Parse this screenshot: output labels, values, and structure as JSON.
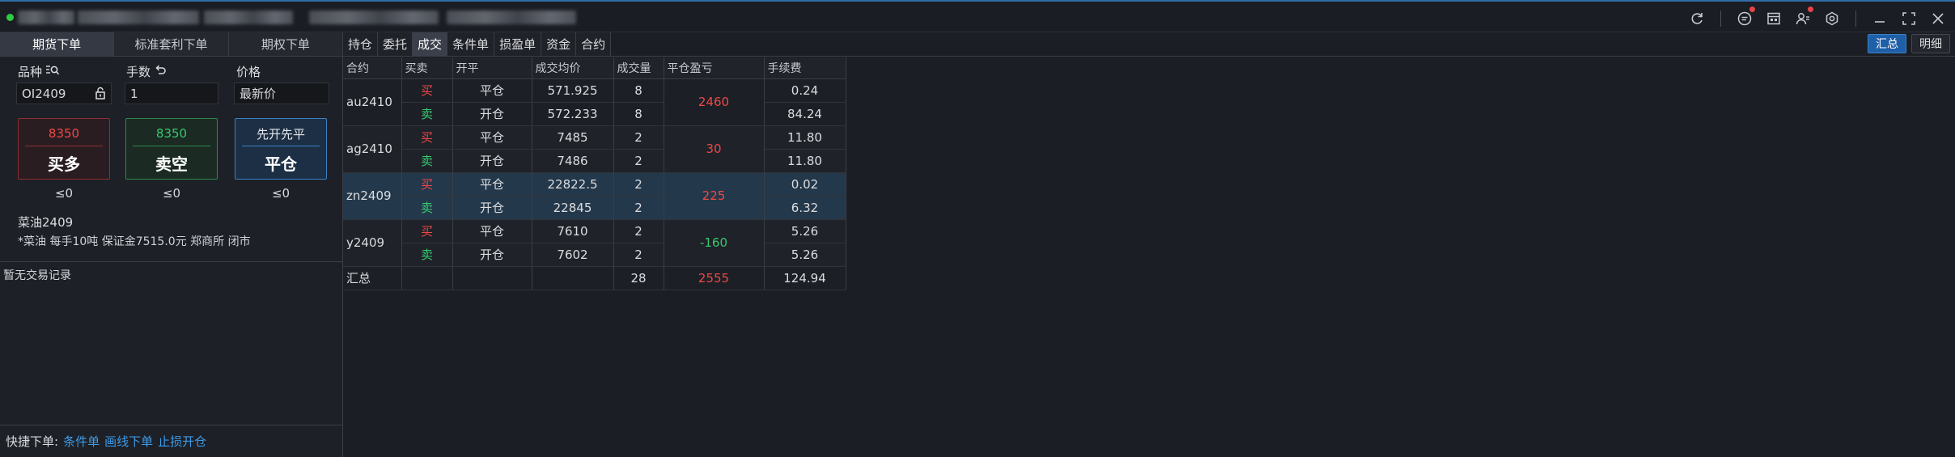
{
  "left": {
    "tabs": [
      "期货下单",
      "标准套利下单",
      "期权下单"
    ],
    "active_tab": 0,
    "labels": {
      "symbol": "品种",
      "lots": "手数",
      "price": "价格"
    },
    "inputs": {
      "symbol": "OI2409",
      "lots": "1",
      "price": "最新价"
    },
    "buy": {
      "price": "8350",
      "label": "买多",
      "limit": "≤0"
    },
    "sell": {
      "price": "8350",
      "label": "卖空",
      "limit": "≤0"
    },
    "close": {
      "hint": "先开先平",
      "label": "平仓",
      "limit": "≤0"
    },
    "contract_name": "菜油2409",
    "contract_info": "*菜油 每手10吨 保证金7515.0元 郑商所 闭市",
    "no_record": "暂无交易记录",
    "quick": {
      "label": "快捷下单:",
      "links": [
        "条件单",
        "画线下单",
        "止损开仓"
      ]
    }
  },
  "right": {
    "tabs": [
      "持仓",
      "委托",
      "成交",
      "条件单",
      "损盈单",
      "资金",
      "合约"
    ],
    "active_tab": 2,
    "view_buttons": [
      "汇总",
      "明细"
    ],
    "active_view": 0,
    "columns": [
      "合约",
      "买卖",
      "开平",
      "成交均价",
      "成交量",
      "平仓盈亏",
      "手续费"
    ],
    "groups": [
      {
        "symbol": "au2410",
        "pnl": "2460",
        "pnl_sign": "pos",
        "rows": [
          {
            "side": "买",
            "offset": "平仓",
            "avg": "571.925",
            "vol": "8",
            "fee": "0.24"
          },
          {
            "side": "卖",
            "offset": "开仓",
            "avg": "572.233",
            "vol": "8",
            "fee": "84.24"
          }
        ]
      },
      {
        "symbol": "ag2410",
        "pnl": "30",
        "pnl_sign": "pos",
        "rows": [
          {
            "side": "买",
            "offset": "平仓",
            "avg": "7485",
            "vol": "2",
            "fee": "11.80"
          },
          {
            "side": "卖",
            "offset": "开仓",
            "avg": "7486",
            "vol": "2",
            "fee": "11.80"
          }
        ]
      },
      {
        "symbol": "zn2409",
        "pnl": "225",
        "pnl_sign": "pos",
        "selected": true,
        "rows": [
          {
            "side": "买",
            "offset": "平仓",
            "avg": "22822.5",
            "vol": "2",
            "fee": "0.02"
          },
          {
            "side": "卖",
            "offset": "开仓",
            "avg": "22845",
            "vol": "2",
            "fee": "6.32"
          }
        ]
      },
      {
        "symbol": "y2409",
        "pnl": "-160",
        "pnl_sign": "neg",
        "rows": [
          {
            "side": "买",
            "offset": "平仓",
            "avg": "7610",
            "vol": "2",
            "fee": "5.26"
          },
          {
            "side": "卖",
            "offset": "开仓",
            "avg": "7602",
            "vol": "2",
            "fee": "5.26"
          }
        ]
      }
    ],
    "total": {
      "label": "汇总",
      "vol": "28",
      "pnl": "2555",
      "fee": "124.94"
    }
  },
  "icons": [
    "refresh-icon",
    "message-icon",
    "calendar-icon",
    "user-settings-icon",
    "settings-icon",
    "minimize-icon",
    "fullscreen-icon",
    "close-icon"
  ],
  "colors": {
    "buy": "#ef4848",
    "sell": "#37c870",
    "accent": "#3b82c4"
  }
}
